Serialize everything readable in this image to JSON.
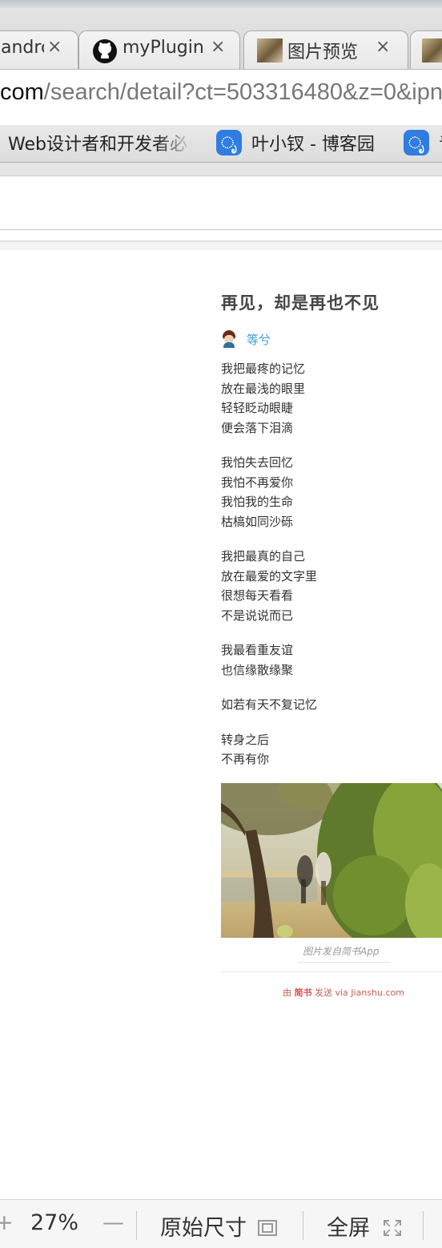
{
  "browser": {
    "tabs": [
      {
        "title": "andrc",
        "icon": "none"
      },
      {
        "title": "myPlugin/",
        "icon": "github-icon"
      },
      {
        "title": "图片预览",
        "icon": "photo-thumbnail-icon"
      }
    ],
    "close_glyph": "×",
    "address": {
      "host": "com",
      "path": "/search/detail?ct=503316480&z=0&ipn"
    },
    "bookmarks": [
      {
        "label": "Web设计者和开发者必"
      },
      {
        "label": "叶小钗 - 博客园",
        "icon": "cnblogs-icon"
      },
      {
        "label": "青",
        "icon": "cnblogs-icon"
      }
    ],
    "bookmark_icon_glyph": "ೃ"
  },
  "article": {
    "title": "再见，却是再也不见",
    "author": "等兮",
    "stanzas": [
      [
        "我把最疼的记忆",
        "放在最浅的眼里",
        "轻轻眨动眼睫",
        "便会落下泪滴"
      ],
      [
        "我怕失去回忆",
        "我怕不再爱你",
        "我怕我的生命",
        "枯槁如同沙砾"
      ],
      [
        "我把最真的自己",
        "放在最爱的文字里",
        "很想每天看看",
        "不是说说而已"
      ],
      [
        "我最看重友谊",
        "也信缘散缘聚"
      ],
      [
        "如若有天不复记忆"
      ],
      [
        "转身之后",
        "不再有你"
      ]
    ],
    "photo_caption": "图片发自简书App",
    "sent_from": {
      "prefix": "由 ",
      "brand": "简书",
      "suffix": " 发送 via Jianshu.com"
    }
  },
  "viewer_toolbar": {
    "zoom_in": "+",
    "zoom_level": "27%",
    "zoom_out": "—",
    "original_size": "原始尺寸",
    "fullscreen": "全屏"
  }
}
